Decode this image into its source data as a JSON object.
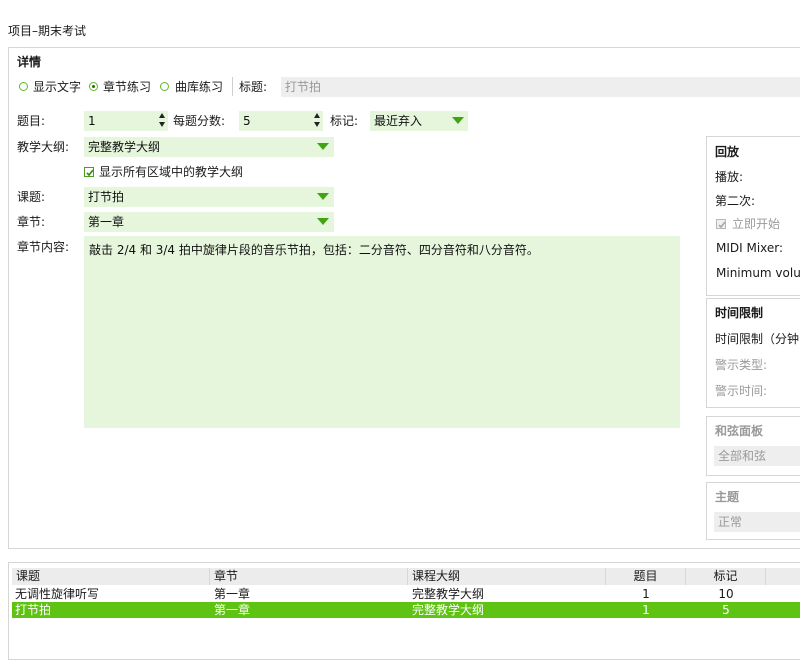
{
  "window": {
    "title": "项目–期末考试"
  },
  "details": {
    "section_title": "详情",
    "view_options": [
      {
        "label": "显示文字",
        "selected": false
      },
      {
        "label": "章节练习",
        "selected": true
      },
      {
        "label": "曲库练习",
        "selected": false
      }
    ],
    "title_label": "标题:",
    "title_value": "打节拍",
    "question_label": "题目:",
    "question_value": "1",
    "score_label": "每题分数:",
    "score_value": "5",
    "mark_label": "标记:",
    "mark_value": "最近弃入",
    "syllabus_label": "教学大纲:",
    "syllabus_value": "完整教学大纲",
    "show_all_label": "显示所有区域中的教学大纲",
    "show_all_checked": true,
    "topic_label": "课题:",
    "topic_value": "打节拍",
    "chapter_label": "章节:",
    "chapter_value": "第一章",
    "content_label": "章节内容:",
    "content_text": "敲击 2/4 和 3/4 拍中旋律片段的音乐节拍，包括：二分音符、四分音符和八分音符。"
  },
  "playback": {
    "title": "回放",
    "play_label": "播放:",
    "second_label": "第二次:",
    "start_now_label": "立即开始",
    "start_now_checked": true,
    "midi_label": "MIDI Mixer:",
    "min_volume_label": "Minimum volum"
  },
  "time_limit": {
    "title": "时间限制",
    "limit_label": "时间限制（分钟",
    "warn_type_label": "警示类型:",
    "warn_time_label": "警示时间:"
  },
  "chord_panel": {
    "title": "和弦面板",
    "value": "全部和弦"
  },
  "theme": {
    "title": "主题",
    "value": "正常"
  },
  "grid": {
    "columns": [
      "课题",
      "章节",
      "课程大纲",
      "题目",
      "标记"
    ],
    "rows": [
      {
        "cells": [
          "无调性旋律听写",
          "第一章",
          "完整教学大纲",
          "1",
          "10"
        ],
        "selected": false
      },
      {
        "cells": [
          "打节拍",
          "第一章",
          "完整教学大纲",
          "1",
          "5"
        ],
        "selected": true
      }
    ]
  },
  "colors": {
    "accent": "#5ec313",
    "field_bg": "#e6f6dc",
    "dropdown_arrow": "#43a413"
  }
}
